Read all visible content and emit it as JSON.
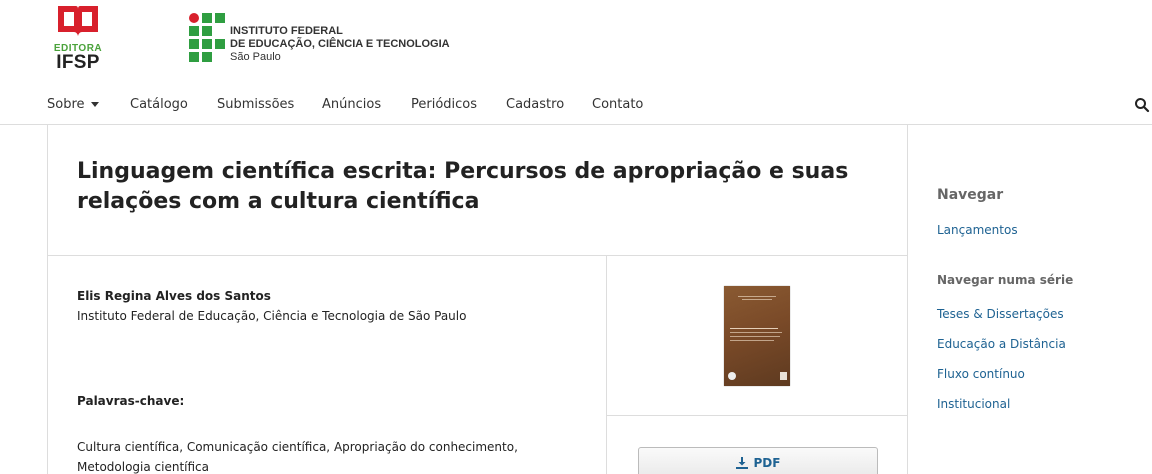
{
  "header": {
    "editora_logo": {
      "small": "EDITORA",
      "big": "IFSP",
      "icon": "open-book-icon",
      "accent": "#d8202c"
    },
    "institute_logo": {
      "line1": "INSTITUTO FEDERAL",
      "line2": "DE EDUCAÇÃO, CIÊNCIA E TECNOLOGIA",
      "line3": "São Paulo",
      "grid_color": "#2f9e41",
      "dot_color": "#d8202c"
    }
  },
  "nav": {
    "items": [
      {
        "label": "Sobre",
        "has_dropdown": true
      },
      {
        "label": "Catálogo"
      },
      {
        "label": "Submissões"
      },
      {
        "label": "Anúncios"
      },
      {
        "label": "Periódicos"
      },
      {
        "label": "Cadastro"
      },
      {
        "label": "Contato"
      }
    ],
    "search_icon": "search-icon"
  },
  "book": {
    "title": "Linguagem científica escrita: Percursos de apropriação e suas relações com a cultura científica",
    "author": {
      "name": "Elis Regina Alves dos Santos",
      "affiliation": "Instituto Federal de Educação, Ciência e Tecnologia de São Paulo"
    },
    "keywords_heading": "Palavras-chave:",
    "keywords": "Cultura científica, Comunicação científica, Apropriação do conhecimento, Metodologia científica",
    "download": {
      "label": "PDF",
      "icon": "download-icon"
    }
  },
  "sidebar": {
    "browse_heading": "Navegar",
    "browse_links": [
      "Lançamentos"
    ],
    "series_heading": "Navegar numa série",
    "series_links": [
      "Teses & Dissertações",
      "Educação a Distância",
      "Fluxo contínuo",
      "Institucional"
    ]
  },
  "colors": {
    "link": "#1e6292",
    "text": "#222222",
    "muted_heading": "#666666",
    "border": "#dddddd"
  }
}
